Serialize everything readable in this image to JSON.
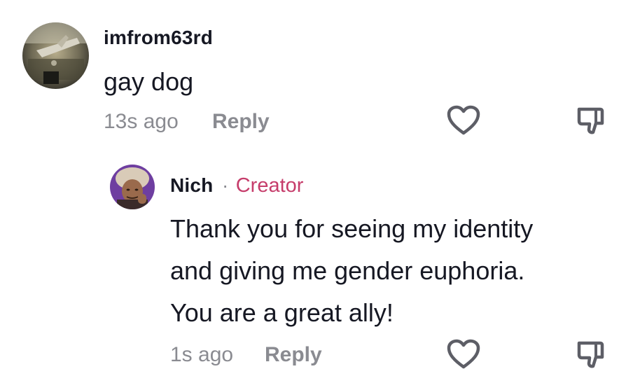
{
  "comment": {
    "avatar_icon": "avatar-photo-icon",
    "username": "imfrom63rd",
    "text": "gay dog",
    "time": "13s ago",
    "reply_label": "Reply",
    "like_icon": "heart-outline-icon",
    "dislike_icon": "thumbs-down-icon"
  },
  "reply": {
    "avatar_icon": "avatar-photo-icon",
    "username": "Nich",
    "separator": "·",
    "badge": "Creator",
    "text_lines": [
      "Thank you for seeing my identity",
      "and giving me gender euphoria.",
      "You are a great ally!"
    ],
    "time": "1s ago",
    "reply_label": "Reply",
    "like_icon": "heart-outline-icon",
    "dislike_icon": "thumbs-down-icon"
  },
  "colors": {
    "text_primary": "#161823",
    "text_secondary": "#8a8b91",
    "creator_accent": "#c63d6b",
    "icon_stroke": "#5d5e66"
  }
}
